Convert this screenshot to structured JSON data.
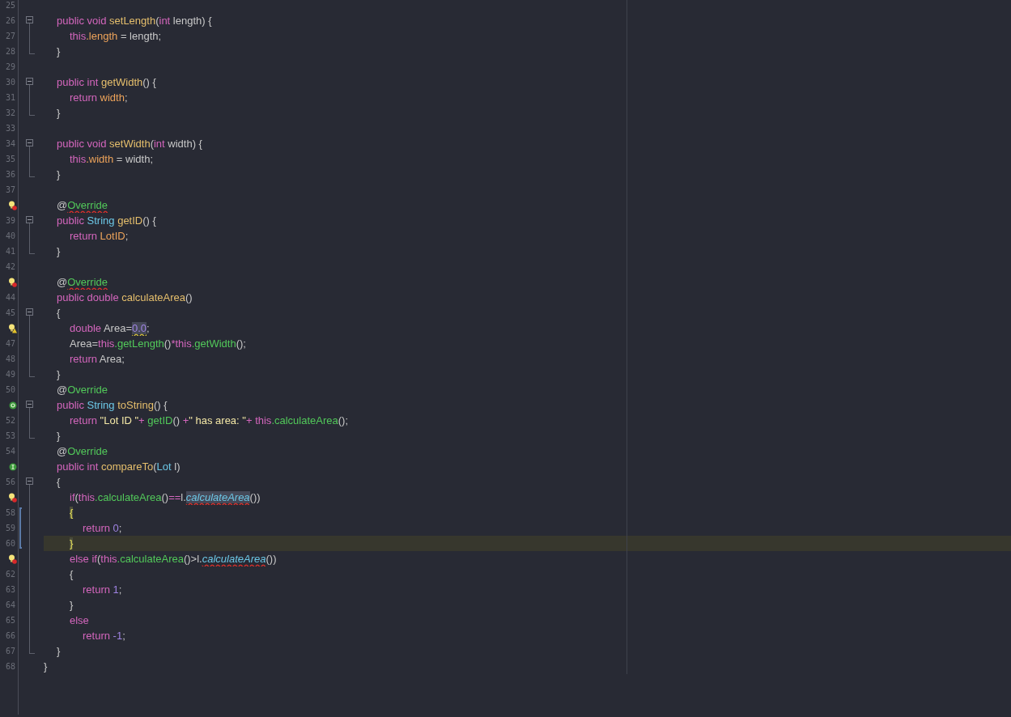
{
  "lines": [
    {
      "number": "25"
    },
    {
      "number": "26",
      "fold": {
        "kind": "start"
      },
      "tokens": [
        {
          "text": "\tpublic void ",
          "kind": "keyword"
        },
        {
          "text": "setLength",
          "kind": "method"
        },
        {
          "text": "(",
          "kind": "plain"
        },
        {
          "text": "int",
          "kind": "keyword"
        },
        {
          "text": " length) {",
          "kind": "plain"
        }
      ]
    },
    {
      "number": "27",
      "fold": {
        "kind": "inside"
      },
      "tokens": [
        {
          "text": "\t\tthis",
          "kind": "keyword"
        },
        {
          "text": ".length",
          "kind": "field"
        },
        {
          "text": " = length;",
          "kind": "plain"
        }
      ]
    },
    {
      "number": "28",
      "fold": {
        "kind": "end"
      },
      "tokens": [
        {
          "text": "\t}",
          "kind": "plain"
        }
      ]
    },
    {
      "number": "29"
    },
    {
      "number": "30",
      "fold": {
        "kind": "start"
      },
      "tokens": [
        {
          "text": "\tpublic int ",
          "kind": "keyword"
        },
        {
          "text": "getWidth",
          "kind": "method"
        },
        {
          "text": "() {",
          "kind": "plain"
        }
      ]
    },
    {
      "number": "31",
      "fold": {
        "kind": "inside"
      },
      "tokens": [
        {
          "text": "\t\treturn ",
          "kind": "keyword"
        },
        {
          "text": "width",
          "kind": "field"
        },
        {
          "text": ";",
          "kind": "plain"
        }
      ]
    },
    {
      "number": "32",
      "fold": {
        "kind": "end"
      },
      "tokens": [
        {
          "text": "\t}",
          "kind": "plain"
        }
      ]
    },
    {
      "number": "33"
    },
    {
      "number": "34",
      "fold": {
        "kind": "start"
      },
      "tokens": [
        {
          "text": "\tpublic void ",
          "kind": "keyword"
        },
        {
          "text": "setWidth",
          "kind": "method"
        },
        {
          "text": "(",
          "kind": "plain"
        },
        {
          "text": "int",
          "kind": "keyword"
        },
        {
          "text": " width) {",
          "kind": "plain"
        }
      ]
    },
    {
      "number": "35",
      "fold": {
        "kind": "inside"
      },
      "tokens": [
        {
          "text": "\t\tthis",
          "kind": "keyword"
        },
        {
          "text": ".width",
          "kind": "field"
        },
        {
          "text": " = width;",
          "kind": "plain"
        }
      ]
    },
    {
      "number": "36",
      "fold": {
        "kind": "end"
      },
      "tokens": [
        {
          "text": "\t}",
          "kind": "plain"
        }
      ]
    },
    {
      "number": "37"
    },
    {
      "gutter_icon": {
        "kind": "bulb-error"
      },
      "tokens": [
        {
          "text": "\t@",
          "kind": "plain"
        },
        {
          "text": "Override",
          "kind": "annotation",
          "error": true
        }
      ]
    },
    {
      "number": "39",
      "fold": {
        "kind": "start"
      },
      "tokens": [
        {
          "text": "\tpublic ",
          "kind": "keyword"
        },
        {
          "text": "String ",
          "kind": "type"
        },
        {
          "text": "getID",
          "kind": "method"
        },
        {
          "text": "() {",
          "kind": "plain"
        }
      ]
    },
    {
      "number": "40",
      "fold": {
        "kind": "inside"
      },
      "tokens": [
        {
          "text": "\t\treturn ",
          "kind": "keyword"
        },
        {
          "text": "LotID",
          "kind": "field"
        },
        {
          "text": ";",
          "kind": "plain"
        }
      ]
    },
    {
      "number": "41",
      "fold": {
        "kind": "end"
      },
      "tokens": [
        {
          "text": "\t}",
          "kind": "plain"
        }
      ]
    },
    {
      "number": "42"
    },
    {
      "gutter_icon": {
        "kind": "bulb-error"
      },
      "tokens": [
        {
          "text": "\t@",
          "kind": "plain"
        },
        {
          "text": "Override",
          "kind": "annotation",
          "error": true
        }
      ]
    },
    {
      "number": "44",
      "tokens": [
        {
          "text": "\tpublic double ",
          "kind": "keyword"
        },
        {
          "text": "calculateArea",
          "kind": "method"
        },
        {
          "text": "()",
          "kind": "plain"
        }
      ]
    },
    {
      "number": "45",
      "fold": {
        "kind": "start"
      },
      "tokens": [
        {
          "text": "\t{",
          "kind": "plain"
        }
      ]
    },
    {
      "gutter_icon": {
        "kind": "bulb-warning"
      },
      "fold": {
        "kind": "inside"
      },
      "tokens": [
        {
          "text": "\t\tdouble ",
          "kind": "keyword"
        },
        {
          "text": "Area=",
          "kind": "plain"
        },
        {
          "text": "0.0",
          "kind": "number",
          "warning": true,
          "highlighted": true
        },
        {
          "text": ";",
          "kind": "plain"
        }
      ]
    },
    {
      "number": "47",
      "fold": {
        "kind": "inside"
      },
      "tokens": [
        {
          "text": "\t\tArea=",
          "kind": "plain"
        },
        {
          "text": "this",
          "kind": "keyword"
        },
        {
          "text": ".getLength",
          "kind": "call"
        },
        {
          "text": "()",
          "kind": "plain"
        },
        {
          "text": "*this",
          "kind": "keyword"
        },
        {
          "text": ".getWidth",
          "kind": "call"
        },
        {
          "text": "();",
          "kind": "plain"
        }
      ]
    },
    {
      "number": "48",
      "fold": {
        "kind": "inside"
      },
      "tokens": [
        {
          "text": "\t\treturn ",
          "kind": "keyword"
        },
        {
          "text": "Area;",
          "kind": "plain"
        }
      ]
    },
    {
      "number": "49",
      "fold": {
        "kind": "end"
      },
      "tokens": [
        {
          "text": "\t}",
          "kind": "plain"
        }
      ]
    },
    {
      "number": "50",
      "tokens": [
        {
          "text": "\t@",
          "kind": "plain"
        },
        {
          "text": "Override",
          "kind": "annotation"
        }
      ]
    },
    {
      "gutter_icon": {
        "kind": "override"
      },
      "fold": {
        "kind": "start"
      },
      "tokens": [
        {
          "text": "\tpublic ",
          "kind": "keyword"
        },
        {
          "text": "String ",
          "kind": "type"
        },
        {
          "text": "toString",
          "kind": "method"
        },
        {
          "text": "() {",
          "kind": "plain"
        }
      ]
    },
    {
      "number": "52",
      "fold": {
        "kind": "inside"
      },
      "tokens": [
        {
          "text": "\t\treturn ",
          "kind": "keyword"
        },
        {
          "text": "\"Lot ID \"",
          "kind": "string"
        },
        {
          "text": "+ ",
          "kind": "keyword"
        },
        {
          "text": "getID",
          "kind": "call"
        },
        {
          "text": "() ",
          "kind": "plain"
        },
        {
          "text": "+",
          "kind": "keyword"
        },
        {
          "text": "\" has area: \"",
          "kind": "string"
        },
        {
          "text": "+ this",
          "kind": "keyword"
        },
        {
          "text": ".calculateArea",
          "kind": "call"
        },
        {
          "text": "();",
          "kind": "plain"
        }
      ]
    },
    {
      "number": "53",
      "fold": {
        "kind": "end"
      },
      "tokens": [
        {
          "text": "\t}",
          "kind": "plain"
        }
      ]
    },
    {
      "number": "54",
      "tokens": [
        {
          "text": "\t@",
          "kind": "plain"
        },
        {
          "text": "Override",
          "kind": "annotation"
        }
      ]
    },
    {
      "gutter_icon": {
        "kind": "implement"
      },
      "tokens": [
        {
          "text": "\tpublic int ",
          "kind": "keyword"
        },
        {
          "text": "compareTo",
          "kind": "method"
        },
        {
          "text": "(",
          "kind": "plain"
        },
        {
          "text": "Lot",
          "kind": "type"
        },
        {
          "text": " l)",
          "kind": "plain"
        }
      ]
    },
    {
      "number": "56",
      "fold": {
        "kind": "start"
      },
      "tokens": [
        {
          "text": "\t{",
          "kind": "plain"
        }
      ]
    },
    {
      "gutter_icon": {
        "kind": "bulb-error"
      },
      "fold": {
        "kind": "inside"
      },
      "tokens": [
        {
          "text": "\t\tif",
          "kind": "keyword"
        },
        {
          "text": "(",
          "kind": "plain"
        },
        {
          "text": "this",
          "kind": "keyword"
        },
        {
          "text": ".calculateArea",
          "kind": "call"
        },
        {
          "text": "()",
          "kind": "plain"
        },
        {
          "text": "==",
          "kind": "keyword"
        },
        {
          "text": "l.",
          "kind": "plain"
        },
        {
          "text": "calculateArea",
          "kind": "unresolved",
          "error": true,
          "highlighted": true
        },
        {
          "text": "())",
          "kind": "plain"
        }
      ]
    },
    {
      "number": "58",
      "fold": {
        "kind": "inside"
      },
      "bracket": {
        "kind": "start"
      },
      "tokens": [
        {
          "text": "\t\t{",
          "kind": "brace",
          "highlighted": true
        }
      ]
    },
    {
      "number": "59",
      "fold": {
        "kind": "inside"
      },
      "bracket": {
        "kind": "inside"
      },
      "tokens": [
        {
          "text": "\t\t\treturn ",
          "kind": "keyword"
        },
        {
          "text": "0",
          "kind": "number"
        },
        {
          "text": ";",
          "kind": "plain"
        }
      ]
    },
    {
      "number": "60",
      "fold": {
        "kind": "inside"
      },
      "bracket": {
        "kind": "end"
      },
      "current": true,
      "tokens": [
        {
          "text": "\t\t}",
          "kind": "brace",
          "highlighted": true
        }
      ]
    },
    {
      "gutter_icon": {
        "kind": "bulb-error"
      },
      "fold": {
        "kind": "inside"
      },
      "tokens": [
        {
          "text": "\t\telse if",
          "kind": "keyword"
        },
        {
          "text": "(",
          "kind": "plain"
        },
        {
          "text": "this",
          "kind": "keyword"
        },
        {
          "text": ".calculateArea",
          "kind": "call"
        },
        {
          "text": "()>l.",
          "kind": "plain"
        },
        {
          "text": "calculateArea",
          "kind": "unresolved",
          "error": true
        },
        {
          "text": "())",
          "kind": "plain"
        }
      ]
    },
    {
      "number": "62",
      "fold": {
        "kind": "inside"
      },
      "tokens": [
        {
          "text": "\t\t{",
          "kind": "plain"
        }
      ]
    },
    {
      "number": "63",
      "fold": {
        "kind": "inside"
      },
      "tokens": [
        {
          "text": "\t\t\treturn ",
          "kind": "keyword"
        },
        {
          "text": "1",
          "kind": "number"
        },
        {
          "text": ";",
          "kind": "plain"
        }
      ]
    },
    {
      "number": "64",
      "fold": {
        "kind": "inside"
      },
      "tokens": [
        {
          "text": "\t\t}",
          "kind": "plain"
        }
      ]
    },
    {
      "number": "65",
      "fold": {
        "kind": "inside"
      },
      "tokens": [
        {
          "text": "\t\telse",
          "kind": "keyword"
        }
      ]
    },
    {
      "number": "66",
      "fold": {
        "kind": "inside"
      },
      "tokens": [
        {
          "text": "\t\t\treturn ",
          "kind": "keyword"
        },
        {
          "text": "-1",
          "kind": "number"
        },
        {
          "text": ";",
          "kind": "plain"
        }
      ]
    },
    {
      "number": "67",
      "fold": {
        "kind": "end"
      },
      "tokens": [
        {
          "text": "\t}",
          "kind": "plain"
        }
      ]
    },
    {
      "number": "68",
      "tokens": [
        {
          "text": "}",
          "kind": "plain"
        }
      ]
    }
  ]
}
